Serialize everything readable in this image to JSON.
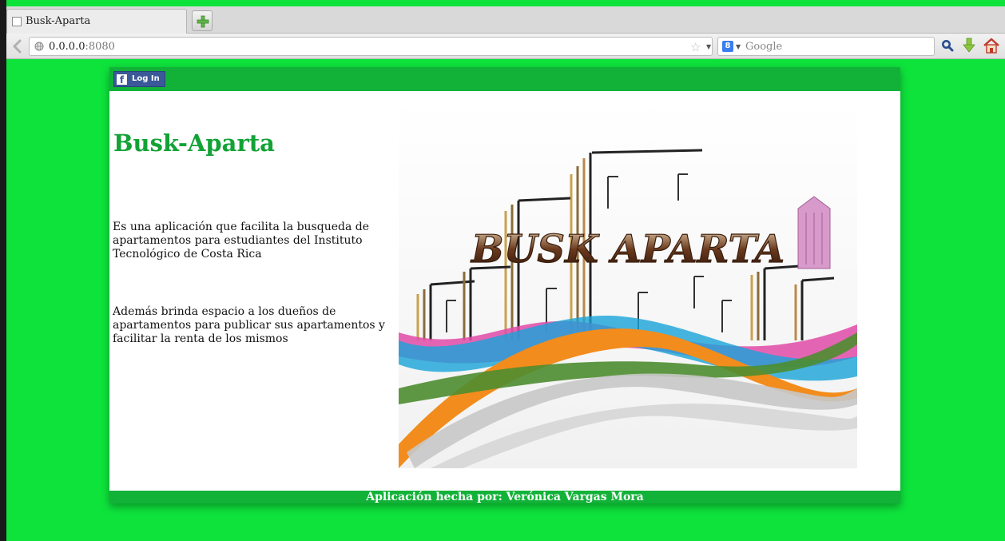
{
  "browser": {
    "tab_title": "Busk-Aparta",
    "url_host": "0.0.0.0",
    "url_port": ":8080",
    "search_placeholder": "Google"
  },
  "page": {
    "login_label": "Log In",
    "site_title": "Busk-Aparta",
    "paragraph_1": "Es una aplicación que facilita la busqueda de apartamentos para estudiantes del Instituto Tecnológico de Costa Rica",
    "paragraph_2": "Además brinda espacio a los dueños de apartamentos para publicar sus apartamentos y facilitar la renta de los mismos",
    "footer_text": "Aplicación hecha por: Verónica Vargas Mora",
    "logo_text": "BUSK APARTA"
  },
  "colors": {
    "page_background": "#0ee33c",
    "header_bar": "#12b238",
    "title_green": "#12a236",
    "facebook_blue": "#3b5998"
  }
}
